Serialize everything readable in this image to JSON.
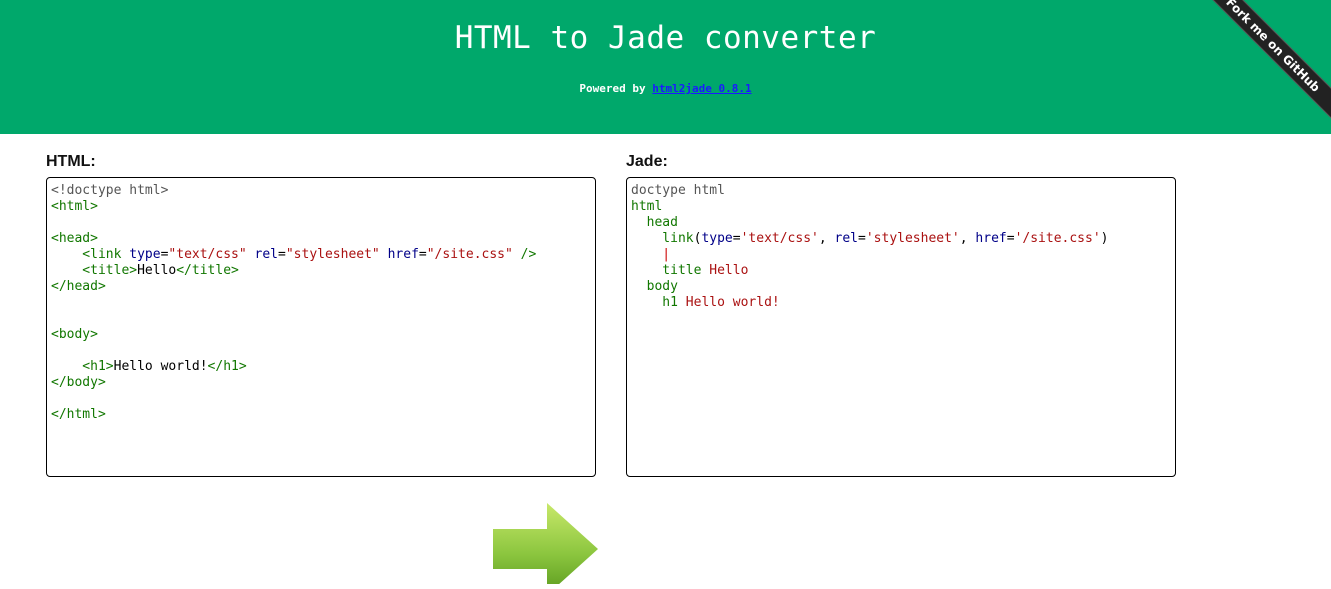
{
  "header": {
    "title": "HTML to Jade converter",
    "powered_prefix": "Powered by",
    "powered_link": "html2jade 0.8.1",
    "ribbon": "Fork me on GitHub",
    "bg_color": "#00a86b"
  },
  "html_panel": {
    "label": "HTML:",
    "lines": [
      [
        {
          "t": "<!doctype html>",
          "c": "gray"
        }
      ],
      [
        {
          "t": "<html>",
          "c": "green"
        }
      ],
      [],
      [
        {
          "t": "<head>",
          "c": "green"
        }
      ],
      [
        {
          "t": "    <link ",
          "c": "green"
        },
        {
          "t": "type",
          "c": "navy"
        },
        {
          "t": "=",
          "c": "black"
        },
        {
          "t": "\"text/css\"",
          "c": "red"
        },
        {
          "t": " ",
          "c": "black"
        },
        {
          "t": "rel",
          "c": "navy"
        },
        {
          "t": "=",
          "c": "black"
        },
        {
          "t": "\"stylesheet\"",
          "c": "red"
        },
        {
          "t": " ",
          "c": "black"
        },
        {
          "t": "href",
          "c": "navy"
        },
        {
          "t": "=",
          "c": "black"
        },
        {
          "t": "\"/site.css\"",
          "c": "red"
        },
        {
          "t": " />",
          "c": "green"
        }
      ],
      [
        {
          "t": "    <title>",
          "c": "green"
        },
        {
          "t": "Hello",
          "c": "black"
        },
        {
          "t": "</title>",
          "c": "green"
        }
      ],
      [
        {
          "t": "</head>",
          "c": "green"
        }
      ],
      [],
      [],
      [
        {
          "t": "<body>",
          "c": "green"
        }
      ],
      [],
      [
        {
          "t": "    <h1>",
          "c": "green"
        },
        {
          "t": "Hello world!",
          "c": "black"
        },
        {
          "t": "</h1>",
          "c": "green"
        }
      ],
      [
        {
          "t": "</body>",
          "c": "green"
        }
      ],
      [],
      [
        {
          "t": "</html>",
          "c": "green"
        }
      ]
    ]
  },
  "jade_panel": {
    "label": "Jade:",
    "lines": [
      [
        {
          "t": "doctype html",
          "c": "gray"
        }
      ],
      [
        {
          "t": "html",
          "c": "green"
        }
      ],
      [
        {
          "t": "  head",
          "c": "green"
        }
      ],
      [
        {
          "t": "    link",
          "c": "green"
        },
        {
          "t": "(",
          "c": "black"
        },
        {
          "t": "type",
          "c": "navy"
        },
        {
          "t": "=",
          "c": "black"
        },
        {
          "t": "'text/css'",
          "c": "darkred"
        },
        {
          "t": ", ",
          "c": "black"
        },
        {
          "t": "rel",
          "c": "navy"
        },
        {
          "t": "=",
          "c": "black"
        },
        {
          "t": "'stylesheet'",
          "c": "darkred"
        },
        {
          "t": ", ",
          "c": "black"
        },
        {
          "t": "href",
          "c": "navy"
        },
        {
          "t": "=",
          "c": "black"
        },
        {
          "t": "'/site.css'",
          "c": "darkred"
        },
        {
          "t": ")",
          "c": "black"
        }
      ],
      [
        {
          "t": "    |",
          "c": "cursor"
        }
      ],
      [
        {
          "t": "    title ",
          "c": "green"
        },
        {
          "t": "Hello",
          "c": "darkred"
        }
      ],
      [
        {
          "t": "  body",
          "c": "green"
        }
      ],
      [
        {
          "t": "    h1 ",
          "c": "green"
        },
        {
          "t": "Hello world!",
          "c": "darkred"
        }
      ]
    ]
  },
  "convert_button": {
    "icon": "right-arrow-icon",
    "color": "#8cc63f"
  }
}
